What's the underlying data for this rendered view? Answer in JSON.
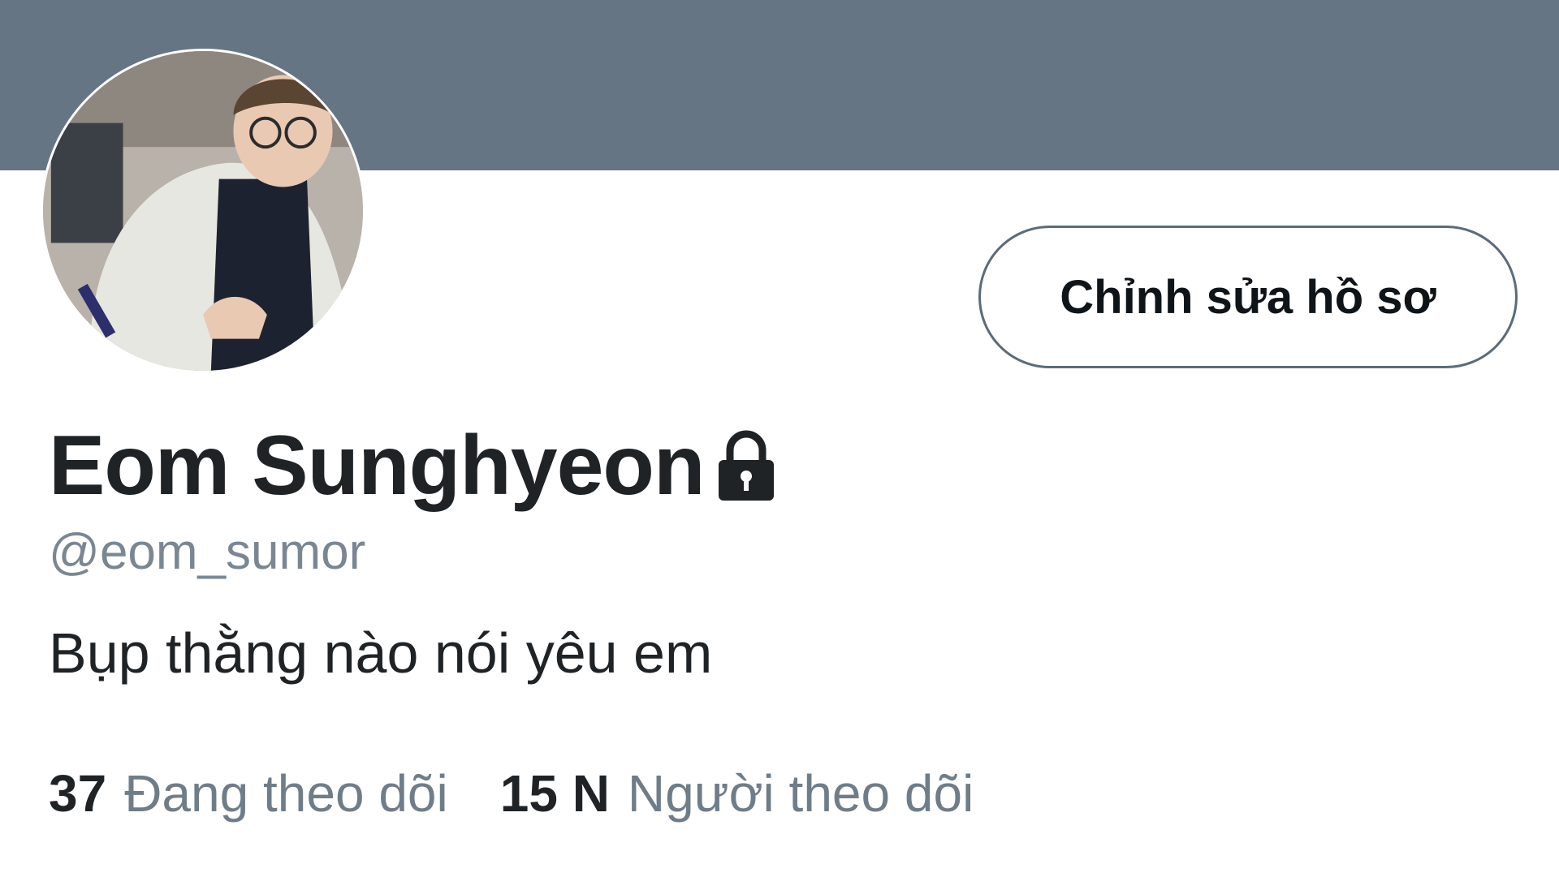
{
  "profile": {
    "display_name": "Eom Sunghyeon",
    "handle": "@eom_sumor",
    "bio": "Bụp thằng nào nói yêu em",
    "protected_icon": "lock-icon",
    "edit_button_label": "Chỉnh sửa hồ sơ"
  },
  "stats": {
    "following_count": "37",
    "following_label": "Đang theo dõi",
    "followers_count": "15 N",
    "followers_label": "Người theo dõi"
  },
  "colors": {
    "banner": "#667584",
    "text_primary": "#1f2326",
    "text_secondary": "#7a8793",
    "button_border": "#5c6b77"
  }
}
